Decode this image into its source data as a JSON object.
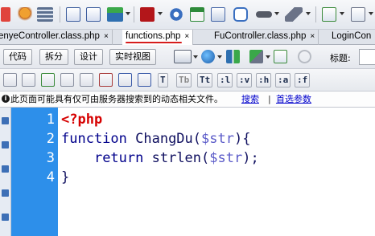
{
  "tabs": [
    {
      "label": "enyeController.class.php",
      "active": false
    },
    {
      "label": "functions.php",
      "active": true
    },
    {
      "label": "FuController.class.php",
      "active": false
    },
    {
      "label": "LoginCon",
      "active": false
    }
  ],
  "tab_close_glyph": "×",
  "view_buttons": {
    "code": "代码",
    "split": "拆分",
    "design": "设计",
    "live": "实时视图"
  },
  "title_label": "标题:",
  "format_buttons": [
    ":l",
    ":v",
    ":h",
    ":a",
    ":f"
  ],
  "format_text_icons": [
    "T",
    "Tb",
    "Tt"
  ],
  "infobar": {
    "icon": "i",
    "message": "此页面可能具有仅可由服务器搜索到的动态相关文件。",
    "link_detect": "搜索",
    "separator": "|",
    "link_settings": "首选参数"
  },
  "editor": {
    "line_numbers": [
      "1",
      "2",
      "3",
      "4"
    ],
    "lines": {
      "l1_open": "<?php",
      "l2_kw": "function",
      "l2_name": " ChangDu(",
      "l2_var": "$str",
      "l2_end": "){",
      "l3_indent": "    ",
      "l3_kw": "return",
      "l3_fn": " strlen(",
      "l3_var": "$str",
      "l3_end": ");",
      "l4": "}"
    }
  },
  "colors": {
    "gutter": "#2d8fea",
    "php_tag": "#d60000",
    "keyword": "#00008b",
    "variable": "#5a5ac8",
    "active_tab_underline": "#d61c1c"
  },
  "icons": {
    "toolbar1": [
      "new-document-icon",
      "insert-icon",
      "table-icon",
      "image-icon",
      "flash-icon",
      "settings-icon",
      "calendar-icon",
      "server-icon",
      "comment-icon",
      "tag-icon",
      "template-icon",
      "snippet-icon",
      "help-icon"
    ],
    "viewbar": [
      "multiscreen-icon",
      "globe-icon",
      "file-transfer-icon",
      "debug-icon",
      "validate-icon",
      "refresh-icon"
    ]
  }
}
